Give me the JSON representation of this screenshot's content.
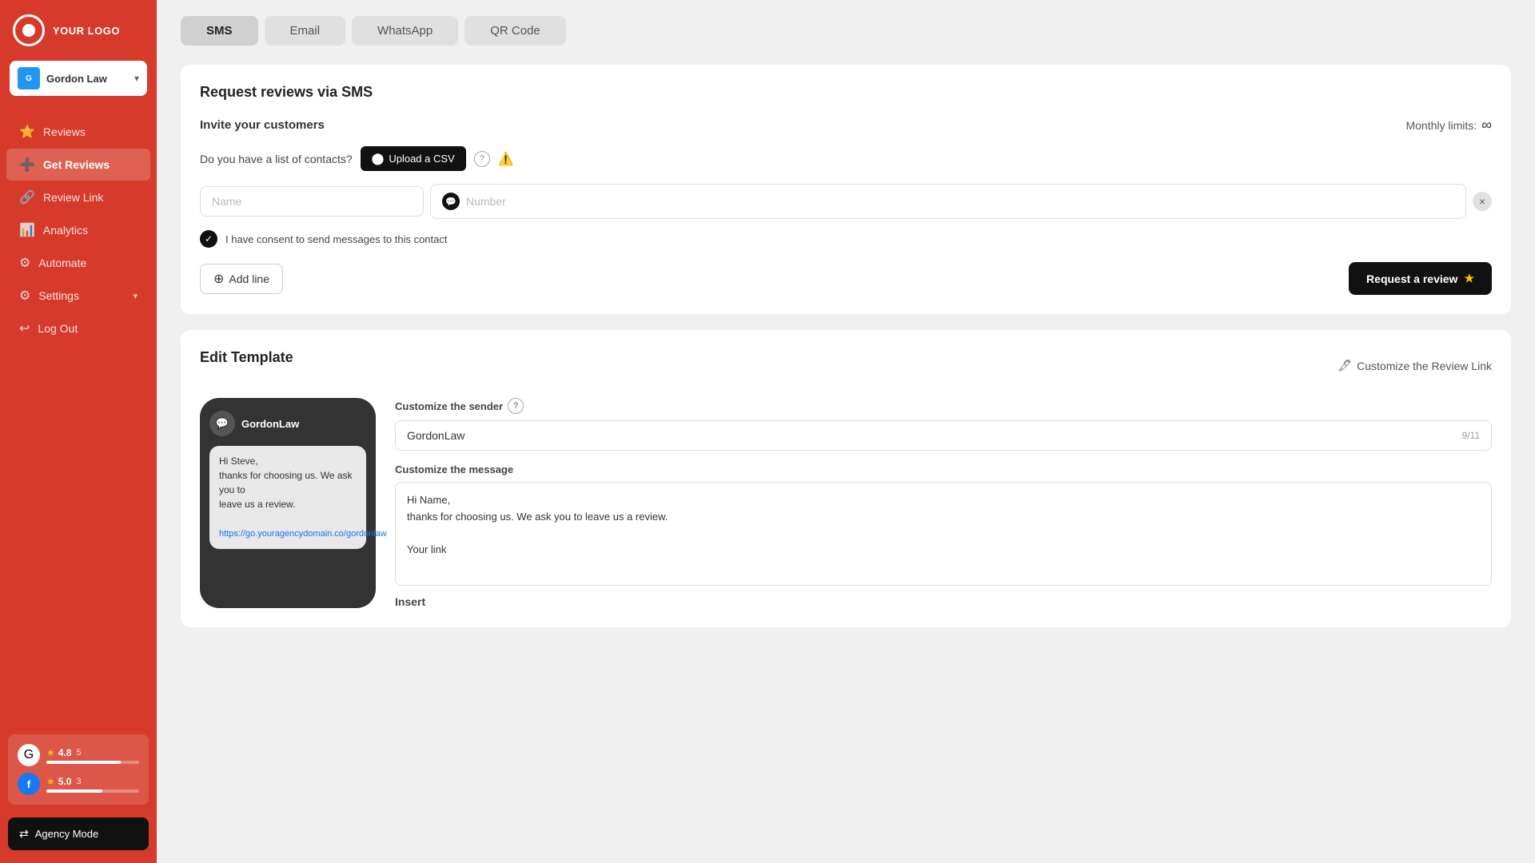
{
  "logo": {
    "text": "YOUR LOGO"
  },
  "account": {
    "name": "Gordon Law",
    "dropdown_label": "Gordon Law"
  },
  "nav": {
    "items": [
      {
        "id": "reviews",
        "label": "Reviews",
        "icon": "⭐"
      },
      {
        "id": "get-reviews",
        "label": "Get Reviews",
        "icon": "＋",
        "active": true
      },
      {
        "id": "review-link",
        "label": "Review Link",
        "icon": "🔗"
      },
      {
        "id": "analytics",
        "label": "Analytics",
        "icon": "📊"
      },
      {
        "id": "automate",
        "label": "Automate",
        "icon": "⚙"
      },
      {
        "id": "settings",
        "label": "Settings",
        "icon": "⚙"
      },
      {
        "id": "log-out",
        "label": "Log Out",
        "icon": "↩"
      }
    ]
  },
  "stats": {
    "google": {
      "score": "4.8",
      "count": "5",
      "bar_width": "80%"
    },
    "facebook": {
      "score": "5.0",
      "count": "3",
      "bar_width": "60%"
    }
  },
  "agency_mode": {
    "label": "Agency Mode"
  },
  "tabs": [
    {
      "id": "sms",
      "label": "SMS",
      "active": true
    },
    {
      "id": "email",
      "label": "Email"
    },
    {
      "id": "whatsapp",
      "label": "WhatsApp"
    },
    {
      "id": "qr-code",
      "label": "QR Code"
    }
  ],
  "invite_section": {
    "title": "Request reviews via SMS",
    "invite_label": "Invite your customers",
    "monthly_limits_label": "Monthly limits:",
    "csv_question": "Do you have a list of contacts?",
    "upload_csv_label": "Upload a CSV",
    "name_placeholder": "Name",
    "number_placeholder": "Number",
    "consent_text": "I have consent to send messages to this contact",
    "add_line_label": "Add line",
    "request_review_label": "Request a review"
  },
  "edit_template": {
    "title": "Edit Template",
    "customize_link_label": "Customize the Review Link",
    "customize_sender_label": "Customize the sender",
    "sender_value": "GordonLaw",
    "char_count": "9/11",
    "customize_message_label": "Customize the message",
    "message_line1": "Hi Name,",
    "message_line2": "thanks for choosing us. We ask you to leave us a",
    "message_line3": "review.",
    "message_line4": "",
    "message_line5": "Your link",
    "insert_label": "Insert",
    "phone_sender": "GordonLaw",
    "phone_message": "Hi Steve,\nthanks for choosing us. We ask you to\nleave us a review.",
    "phone_link": "https://go.youragencydomain.co/gordonlaw"
  }
}
